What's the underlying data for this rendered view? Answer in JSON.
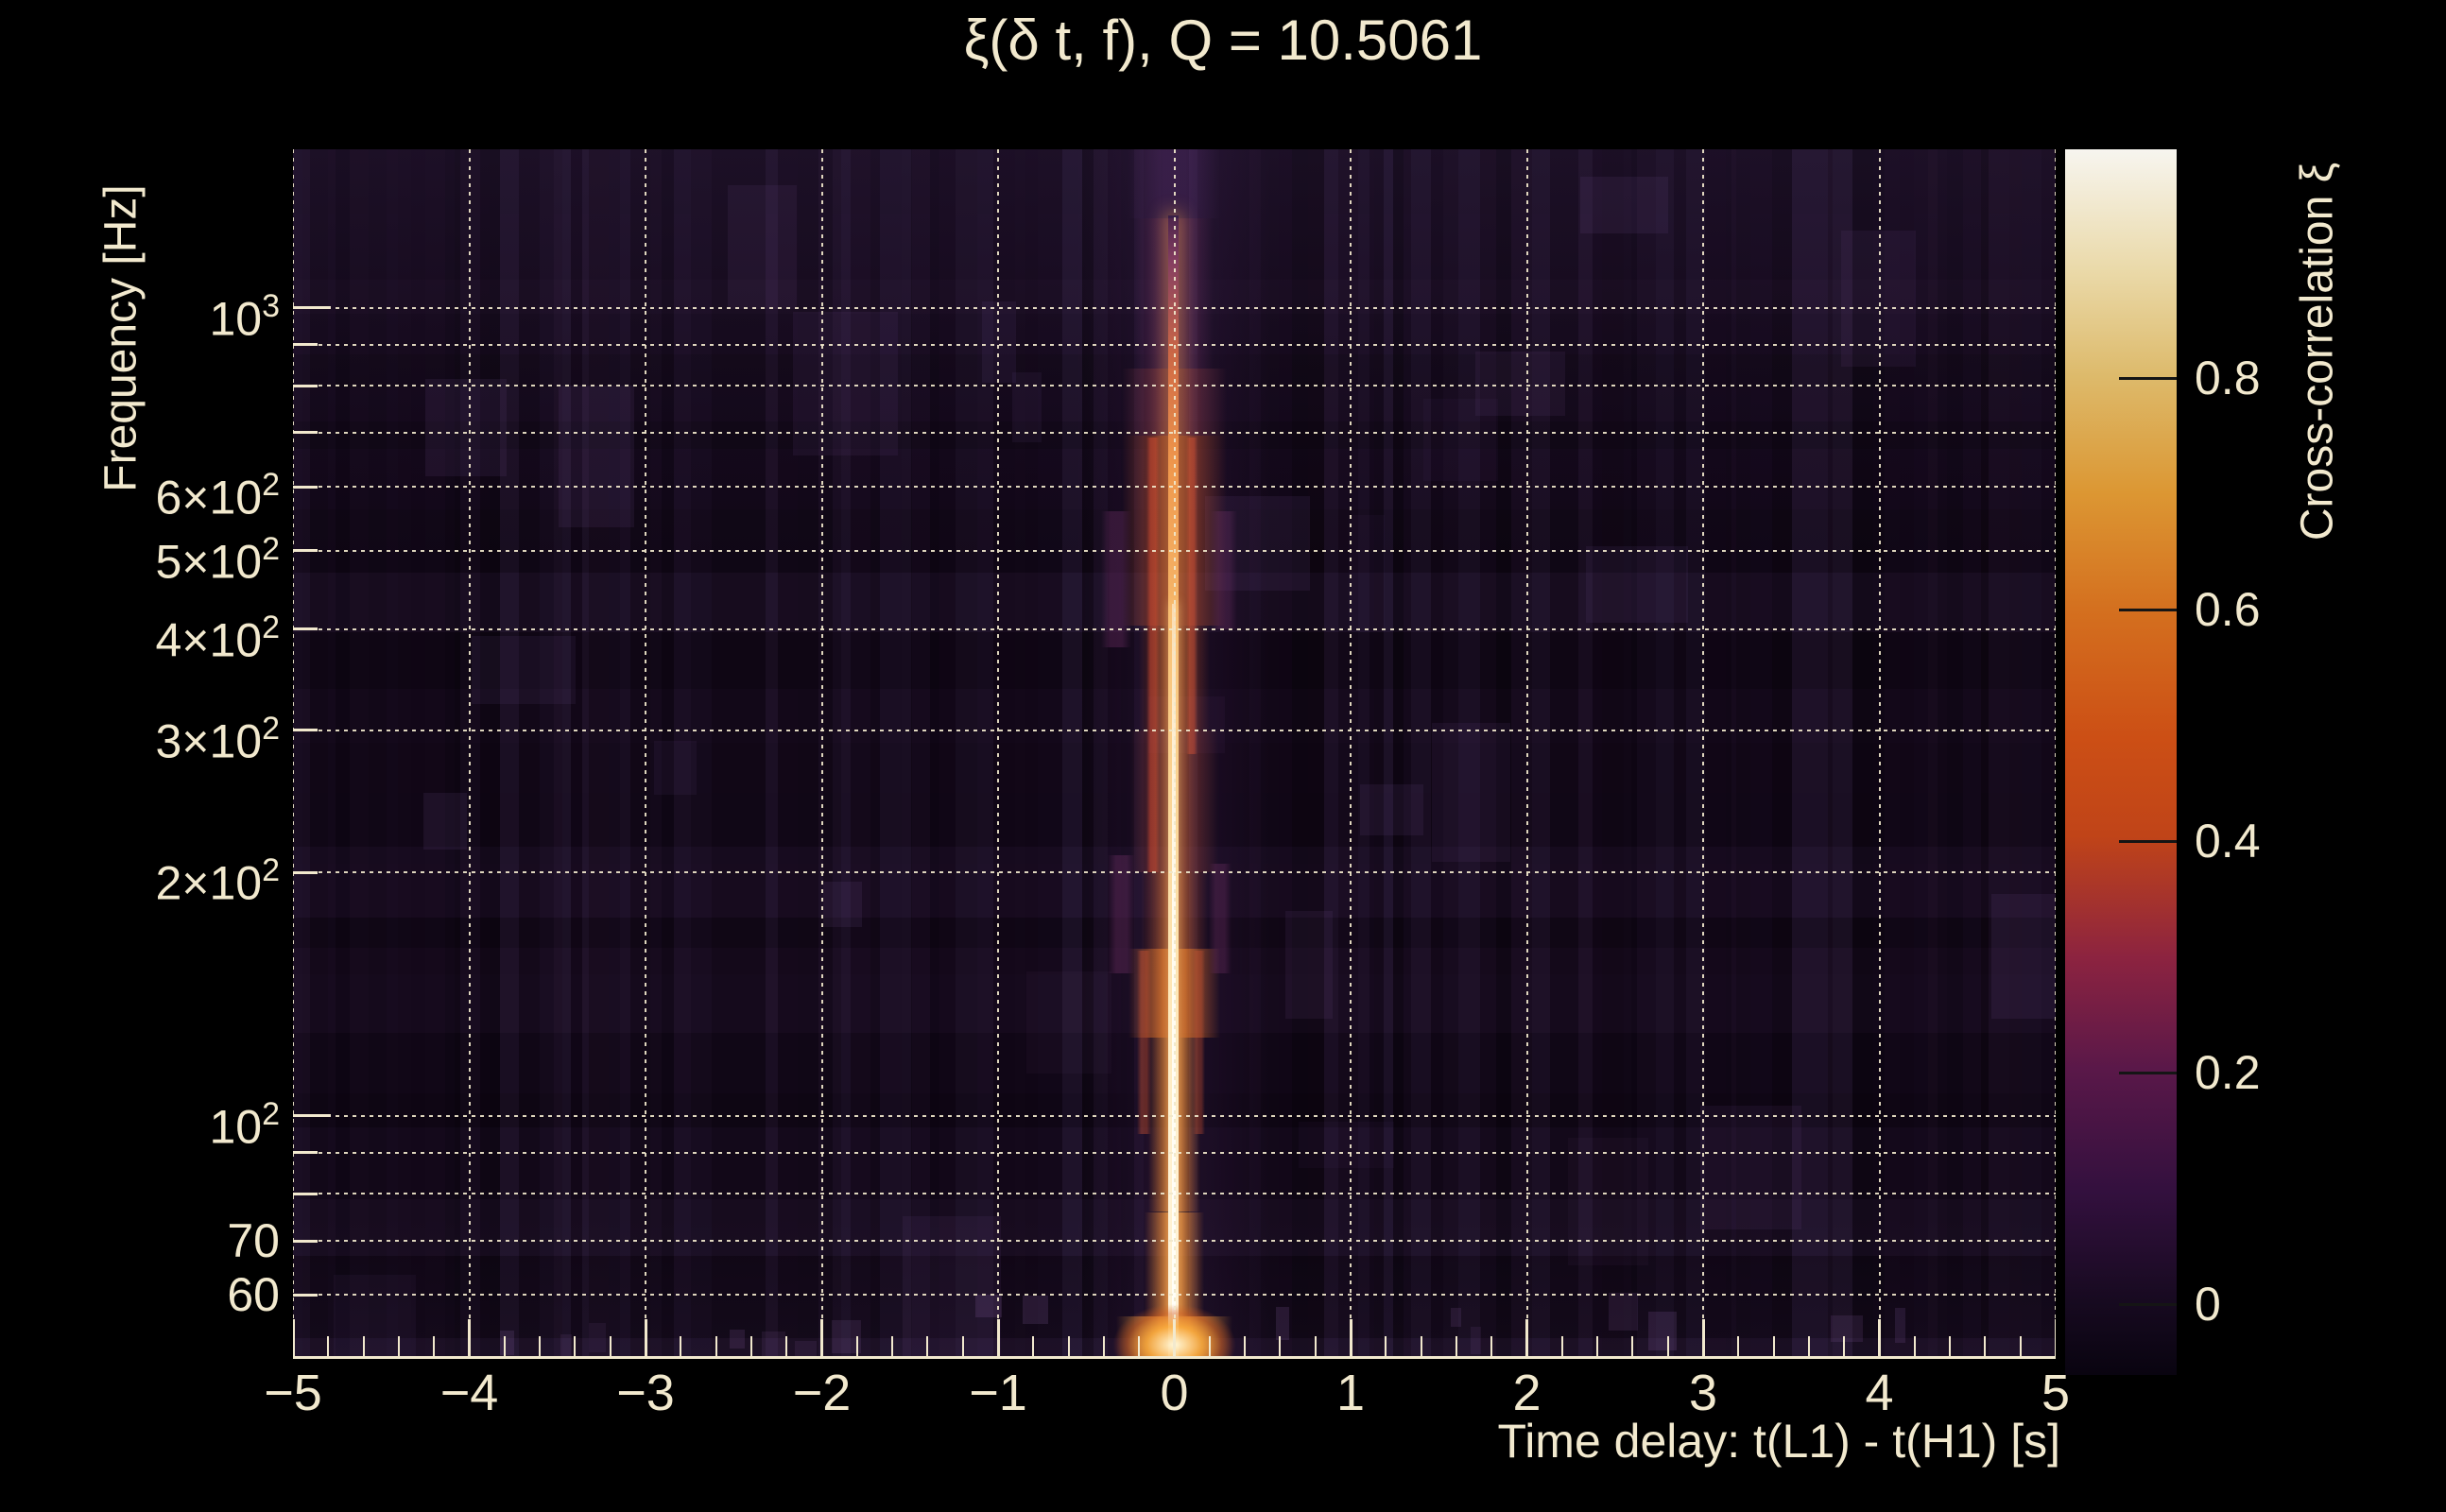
{
  "colors": {
    "background": "#000000",
    "text": "#f2e9ce",
    "grid": "#efe7cb",
    "axis": "#f2e9ce",
    "plot_base": "#120818",
    "colorbar_tick": "#151515"
  },
  "chart_data": {
    "type": "heatmap",
    "title": "ξ(δ t, f), Q = 10.5061",
    "xlabel": "Time delay: t(L1) - t(H1) [s]",
    "ylabel": "Frequency [Hz]",
    "x_range": [
      -5,
      5
    ],
    "x_unit": "s",
    "y_scale": "log",
    "y_range_hz": [
      50,
      1570
    ],
    "grid_style": "dotted",
    "x_major_ticks": [
      {
        "v": -5,
        "label": "−5"
      },
      {
        "v": -4,
        "label": "−4"
      },
      {
        "v": -3,
        "label": "−3"
      },
      {
        "v": -2,
        "label": "−2"
      },
      {
        "v": -1,
        "label": "−1"
      },
      {
        "v": 0,
        "label": "0"
      },
      {
        "v": 1,
        "label": "1"
      },
      {
        "v": 2,
        "label": "2"
      },
      {
        "v": 3,
        "label": "3"
      },
      {
        "v": 4,
        "label": "4"
      },
      {
        "v": 5,
        "label": "5"
      }
    ],
    "x_minor_step": 0.2,
    "y_gridlines_hz": [
      60,
      70,
      80,
      90,
      100,
      200,
      300,
      400,
      500,
      600,
      700,
      800,
      900,
      1000
    ],
    "y_tick_labels": [
      {
        "hz": 1000,
        "base": "10",
        "exp": "3"
      },
      {
        "hz": 600,
        "base": "6×10",
        "exp": "2"
      },
      {
        "hz": 500,
        "base": "5×10",
        "exp": "2"
      },
      {
        "hz": 400,
        "base": "4×10",
        "exp": "2"
      },
      {
        "hz": 300,
        "base": "3×10",
        "exp": "2"
      },
      {
        "hz": 200,
        "base": "2×10",
        "exp": "2"
      },
      {
        "hz": 100,
        "base": "10",
        "exp": "2"
      },
      {
        "hz": 70,
        "base": "70",
        "exp": ""
      },
      {
        "hz": 60,
        "base": "60",
        "exp": ""
      }
    ],
    "colorbar": {
      "label": "Cross-correlation ξ",
      "range": [
        -0.06,
        1.0
      ],
      "ticks": [
        {
          "v": 0.0,
          "label": "0"
        },
        {
          "v": 0.2,
          "label": "0.2"
        },
        {
          "v": 0.4,
          "label": "0.4"
        },
        {
          "v": 0.6,
          "label": "0.6"
        },
        {
          "v": 0.8,
          "label": "0.8"
        }
      ],
      "gradient_stops": [
        [
          0.0,
          "#090410"
        ],
        [
          0.06,
          "#170a20"
        ],
        [
          0.15,
          "#33103e"
        ],
        [
          0.25,
          "#5a1849"
        ],
        [
          0.34,
          "#8c2340"
        ],
        [
          0.44,
          "#c04418"
        ],
        [
          0.52,
          "#cc4f15"
        ],
        [
          0.625,
          "#d4701f"
        ],
        [
          0.72,
          "#dc9733"
        ],
        [
          0.815,
          "#ddba6b"
        ],
        [
          0.9,
          "#ead9a8"
        ],
        [
          1.0,
          "#f7f5ef"
        ]
      ]
    },
    "ridge": {
      "delay_s": 0.0,
      "peak_xi": 1.0,
      "description": "Bright cross-correlation ridge at zero time delay spanning ~50–1300 Hz, widest and brightest near 50–160 Hz and 400–700 Hz, fading to faint purple above ~900 Hz"
    },
    "features": {
      "halo": {
        "delay_s": 0.0,
        "half_width_s": 0.55,
        "f_lo": 50,
        "f_hi": 1570,
        "color": "rgba(100,55,130,0.13)"
      },
      "segments": [
        {
          "f_lo": 1290,
          "f_hi": 1570,
          "half_width_s": 0.26,
          "color": "rgba(115,62,142,0.25)"
        },
        {
          "f_lo": 840,
          "f_hi": 1290,
          "half_width_s": 0.22,
          "color": "rgba(160,72,135,0.32)"
        },
        {
          "f_lo": 695,
          "f_hi": 840,
          "half_width_s": 0.3,
          "color": "rgba(195,82,92,0.40)"
        },
        {
          "f_lo": 404,
          "f_hi": 695,
          "half_width_s": 0.3,
          "color": "rgba(226,96,46,0.50)"
        },
        {
          "f_lo": 300,
          "f_hi": 404,
          "half_width_s": 0.2,
          "color": "rgba(226,100,46,0.46)"
        },
        {
          "f_lo": 200,
          "f_hi": 300,
          "half_width_s": 0.25,
          "color": "rgba(205,88,62,0.42)"
        },
        {
          "f_lo": 161,
          "f_hi": 200,
          "half_width_s": 0.19,
          "color": "rgba(218,98,52,0.48)"
        },
        {
          "f_lo": 125,
          "f_hi": 161,
          "half_width_s": 0.26,
          "color": "rgba(242,122,42,0.70)"
        },
        {
          "f_lo": 76,
          "f_hi": 125,
          "half_width_s": 0.15,
          "color": "rgba(242,132,52,0.62)"
        },
        {
          "f_lo": 56.5,
          "f_hi": 76,
          "half_width_s": 0.17,
          "color": "rgba(246,142,56,0.70)"
        },
        {
          "f_lo": 50,
          "f_hi": 56.5,
          "half_width_s": 0.33,
          "color": "rgba(250,162,62,0.85)"
        }
      ],
      "side_lobes": [
        {
          "delay_s": -0.12,
          "width_s": 0.05,
          "f_lo": 200,
          "f_hi": 690,
          "color": "rgba(212,72,46,0.50)"
        },
        {
          "delay_s": 0.1,
          "width_s": 0.04,
          "f_lo": 280,
          "f_hi": 690,
          "color": "rgba(212,76,50,0.45)"
        },
        {
          "delay_s": -0.33,
          "width_s": 0.15,
          "f_lo": 380,
          "f_hi": 560,
          "color": "rgba(122,52,112,0.32)"
        },
        {
          "delay_s": 0.28,
          "width_s": 0.13,
          "f_lo": 400,
          "f_hi": 560,
          "color": "rgba(117,50,107,0.30)"
        },
        {
          "delay_s": -0.3,
          "width_s": 0.13,
          "f_lo": 150,
          "f_hi": 210,
          "color": "rgba(132,56,117,0.30)"
        },
        {
          "delay_s": 0.26,
          "width_s": 0.11,
          "f_lo": 150,
          "f_hi": 205,
          "color": "rgba(127,53,112,0.28)"
        },
        {
          "delay_s": -0.17,
          "width_s": 0.06,
          "f_lo": 95,
          "f_hi": 160,
          "color": "rgba(210,85,50,0.40)"
        },
        {
          "delay_s": 0.14,
          "width_s": 0.05,
          "f_lo": 95,
          "f_hi": 160,
          "color": "rgba(205,82,50,0.36)"
        }
      ],
      "core": {
        "delay_s": -0.005,
        "width_s": 0.045,
        "f_lo": 50,
        "f_hi": 1300
      },
      "hotline": {
        "delay_s": -0.003,
        "width_s": 0.018,
        "f_lo": 50,
        "f_hi": 430
      },
      "bottom_blob": {
        "delay_s": 0.0,
        "f_center": 53,
        "half_width_s": 0.45
      }
    }
  }
}
